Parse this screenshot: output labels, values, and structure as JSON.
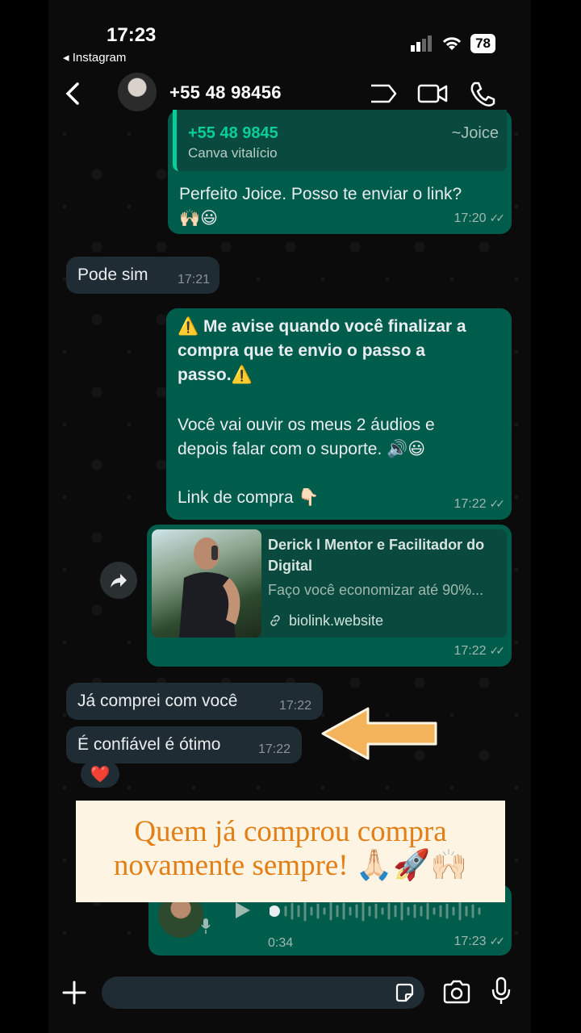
{
  "status": {
    "time": "17:23",
    "back_app": "Instagram",
    "battery": "78"
  },
  "header": {
    "contact": "+55 48 98456"
  },
  "messages": {
    "quote_number": "+55 48 9845",
    "quote_author": "~Joice",
    "quote_text": "Canva vitalício",
    "m1_text1": "Perfeito Joice. Posso te enviar o link?",
    "m1_emoji": "🙌🏻😃",
    "m1_time": "17:20",
    "m2_text": "Pode sim",
    "m2_time": "17:21",
    "m3_line1": "⚠️ Me avise quando você finalizar a",
    "m3_line2": "compra que te envio o passo a",
    "m3_line3": "passo.⚠️",
    "m3_line4": "Você vai ouvir os meus 2 áudios e",
    "m3_line5": "depois falar com o suporte. 🔊😃",
    "m3_line6": "Link de compra 👇🏻",
    "m3_time": "17:22",
    "card_title1": "Derick l Mentor e Facilitador do",
    "card_title2": "Digital",
    "card_desc": "Faço você economizar até 90%...",
    "card_link": "biolink.website",
    "card_time": "17:22",
    "m5_text": "Já comprei com você",
    "m5_time": "17:22",
    "m6_text": "É confiável é ótimo",
    "m6_time": "17:22",
    "reaction": "❤️",
    "audio_duration": "0:34",
    "audio_time": "17:23"
  },
  "caption": {
    "line1": "Quem já comprou compra",
    "line2": "novamente sempre! 🙏🏻🚀🙌🏻"
  },
  "colors": {
    "outgoing": "#005c4b",
    "incoming": "#202c33",
    "accent": "#06cf9c",
    "caption_text": "#e27f16"
  },
  "icons": [
    "back-icon",
    "video-call-icon",
    "voice-call-icon",
    "link-icon",
    "share-icon",
    "plus-icon",
    "sticker-icon",
    "camera-icon",
    "mic-icon",
    "play-icon"
  ]
}
